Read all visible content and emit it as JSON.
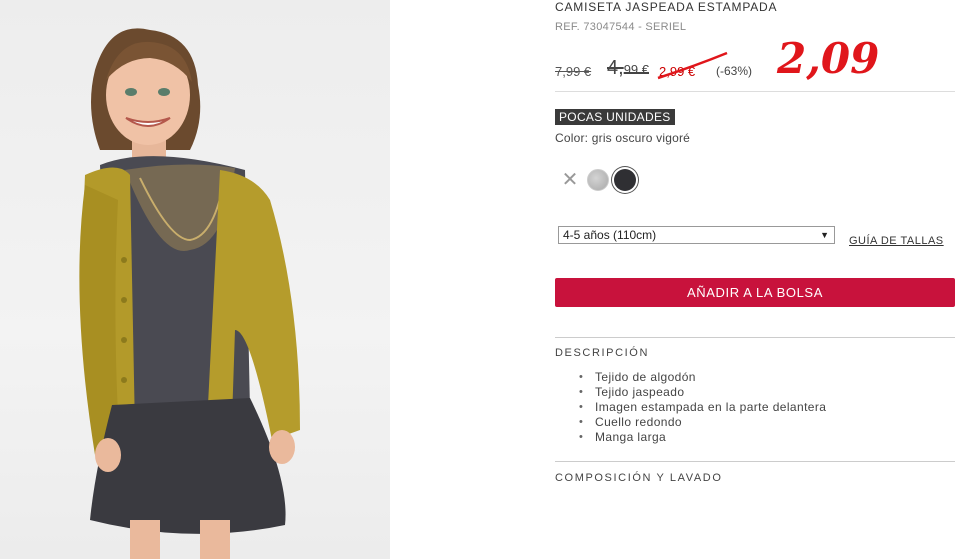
{
  "product": {
    "title": "CAMISETA JASPEADA ESTAMPADA",
    "ref": "REF. 73047544 - SERIEL",
    "price_original": "7,99 €",
    "price_previous_main": "4,",
    "price_previous_cents": "99 €",
    "price_current": "2,99 €",
    "discount": "(-63%)",
    "handwritten_price": "2,09",
    "stock_badge": "POCAS UNIDADES",
    "color_label": "Color: gris oscuro vigoré"
  },
  "swatches": [
    {
      "name": "unavailable",
      "glyph": "✕",
      "color": "#999999"
    },
    {
      "name": "light-grey",
      "color": "#c2c2c2"
    },
    {
      "name": "dark-grey",
      "color": "#2f2f33",
      "selected": true
    }
  ],
  "size": {
    "selected": "4-5 años (110cm)",
    "guide_label": "GUÍA DE TALLAS"
  },
  "cart": {
    "add_label": "AÑADIR A LA BOLSA"
  },
  "description": {
    "heading": "DESCRIPCIÓN",
    "items": [
      "Tejido de algodón",
      "Tejido jaspeado",
      "Imagen estampada en la parte delantera",
      "Cuello redondo",
      "Manga larga"
    ]
  },
  "composition": {
    "heading": "COMPOSICIÓN Y LAVADO"
  },
  "colors": {
    "accent": "#c8123c",
    "annotation": "#e0161b"
  }
}
